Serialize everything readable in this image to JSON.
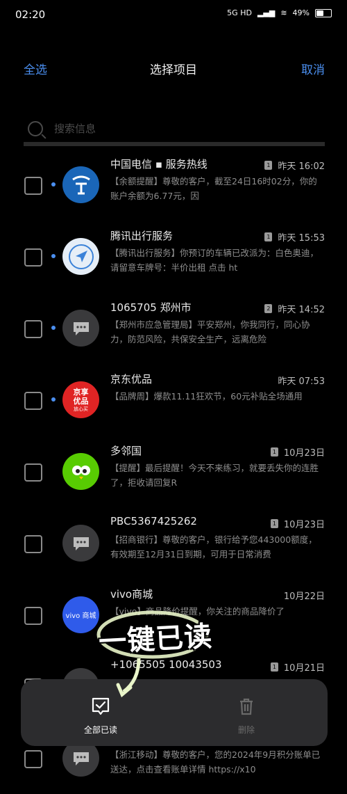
{
  "status_bar": {
    "time": "02:20",
    "network": "5G HD",
    "battery": "49"
  },
  "header": {
    "select_all": "全选",
    "title": "选择项目",
    "cancel": "取消"
  },
  "search": {
    "placeholder": "搜索信息"
  },
  "messages": [
    {
      "sender": "中国电信 ▪ 服务热线",
      "sim": "1",
      "time": "昨天 16:02",
      "preview": "【余额提醒】尊敬的客户，截至24日16时02分，你的账户余额为6.77元，因"
    },
    {
      "sender": "腾讯出行服务",
      "sim": "1",
      "time": "昨天 15:53",
      "preview": "【腾讯出行服务】你预订的车辆已改派为：白色奥迪，请留意车牌号：半价出租 点击 ht"
    },
    {
      "sender": "1065705 郑州市",
      "sim": "2",
      "time": "昨天 14:52",
      "preview": "【郑州市应急管理局】平安郑州，你我同行，同心协力，防范风险，共保安全生产，远离危险"
    },
    {
      "sender": "京东优品",
      "sim": "",
      "time": "昨天 07:53",
      "preview": "【品牌周】爆款11.11狂欢节，60元补贴全场通用"
    },
    {
      "sender": "多邻国",
      "sim": "1",
      "time": "10月23日",
      "preview": "【提醒】最后提醒！今天不来练习，就要丢失你的连胜了，拒收请回复R"
    },
    {
      "sender": "PBC5367425262",
      "sim": "1",
      "time": "10月23日",
      "preview": "【招商银行】尊敬的客户，银行给予您443000额度，有效期至12月31日到期，可用于日常消费"
    },
    {
      "sender": "vivo商城",
      "sim": "",
      "time": "10月22日",
      "preview": "【vivo】商品降价提醒，你关注的商品降价了"
    },
    {
      "sender": "+1065505 10043503",
      "sim": "1",
      "time": "10月21日",
      "preview": ""
    },
    {
      "sender": "",
      "sim": "",
      "time": "",
      "preview": "【浙江移动】尊敬的客户，您的2024年9月积分账单已送达，点击查看账单详情 https://x10"
    }
  ],
  "avatars": [
    {
      "type": "telecom",
      "color": "#1a66b8"
    },
    {
      "type": "tencent",
      "color": "#e6eef7"
    },
    {
      "type": "default",
      "color": "#3a3a3c"
    },
    {
      "type": "jd",
      "color": "#e02424",
      "text_line1": "京享",
      "text_line2": "优品",
      "text_line3": "放心买"
    },
    {
      "type": "duolingo",
      "color": "#58cc02"
    },
    {
      "type": "default",
      "color": "#3a3a3c"
    },
    {
      "type": "vivo",
      "color": "#2f5bea",
      "text": "vivo 商城"
    },
    {
      "type": "default",
      "color": "#3a3a3c"
    },
    {
      "type": "default",
      "color": "#3a3a3c"
    }
  ],
  "actions": {
    "mark_read": "全部已读",
    "delete": "删除"
  },
  "overlay": {
    "caption": "一键已读"
  },
  "colors": {
    "accent": "#4b8ff0",
    "background": "#000000",
    "action_bar": "#2c2c2e"
  }
}
